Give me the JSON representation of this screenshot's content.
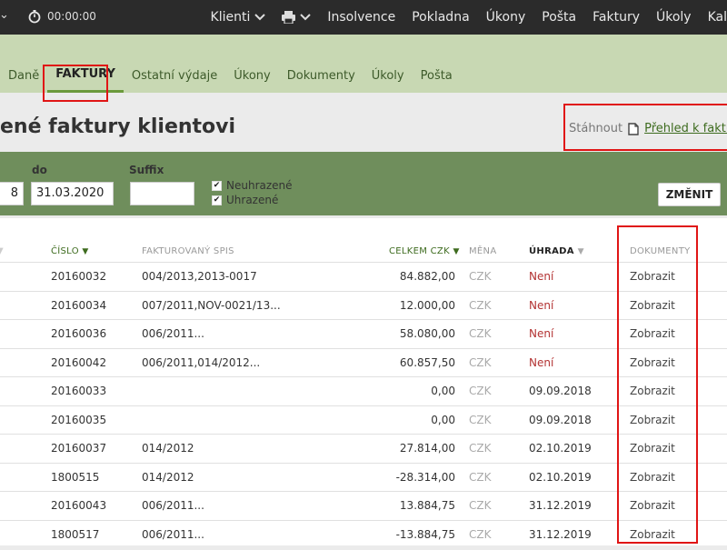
{
  "topbar": {
    "timer": "00:00:00",
    "nav": [
      {
        "label": "Klienti",
        "dropdown": true
      },
      {
        "label": "",
        "icon": "printer-icon",
        "dropdown": true
      },
      {
        "label": "Insolvence"
      },
      {
        "label": "Pokladna"
      },
      {
        "label": "Úkony"
      },
      {
        "label": "Pošta"
      },
      {
        "label": "Faktury"
      },
      {
        "label": "Úkoly"
      },
      {
        "label": "Kal"
      }
    ]
  },
  "tabs": [
    "Daně",
    "FAKTURY",
    "Ostatní výdaje",
    "Úkony",
    "Dokumenty",
    "Úkoly",
    "Pošta"
  ],
  "title": "ené faktury klientovi",
  "download": {
    "label": "Stáhnout",
    "link": "Přehled k fakturac"
  },
  "filter": {
    "from_label": "",
    "from_value": "8",
    "to_label": "do",
    "to_value": "31.03.2020",
    "suffix_label": "Suffix",
    "suffix_value": "",
    "checks": [
      {
        "label": "Neuhrazené",
        "checked": true
      },
      {
        "label": "Uhrazené",
        "checked": true
      }
    ],
    "button": "ZMĚNIT"
  },
  "table": {
    "headers": {
      "cislo": "ČÍSLO",
      "spis": "FAKTUROVANÝ SPIS",
      "celkem": "CELKEM CZK",
      "mena": "MĚNA",
      "uhrada": "ÚHRADA",
      "dokumenty": "DOKUMENTY"
    },
    "rows": [
      {
        "cislo": "20160032",
        "spis": "004/2013,2013-0017",
        "celkem": "84.882,00",
        "mena": "CZK",
        "uhrada": "Není",
        "unpaid": true,
        "doc": "Zobrazit"
      },
      {
        "cislo": "20160034",
        "spis": "007/2011,NOV-0021/13...",
        "celkem": "12.000,00",
        "mena": "CZK",
        "uhrada": "Není",
        "unpaid": true,
        "doc": "Zobrazit"
      },
      {
        "cislo": "20160036",
        "spis": "006/2011...",
        "celkem": "58.080,00",
        "mena": "CZK",
        "uhrada": "Není",
        "unpaid": true,
        "doc": "Zobrazit"
      },
      {
        "cislo": "20160042",
        "spis": "006/2011,014/2012...",
        "celkem": "60.857,50",
        "mena": "CZK",
        "uhrada": "Není",
        "unpaid": true,
        "doc": "Zobrazit"
      },
      {
        "cislo": "20160033",
        "spis": "",
        "celkem": "0,00",
        "mena": "CZK",
        "uhrada": "09.09.2018",
        "unpaid": false,
        "doc": "Zobrazit"
      },
      {
        "cislo": "20160035",
        "spis": "",
        "celkem": "0,00",
        "mena": "CZK",
        "uhrada": "09.09.2018",
        "unpaid": false,
        "doc": "Zobrazit"
      },
      {
        "cislo": "20160037",
        "spis": "014/2012",
        "celkem": "27.814,00",
        "mena": "CZK",
        "uhrada": "02.10.2019",
        "unpaid": false,
        "doc": "Zobrazit"
      },
      {
        "cislo": "1800515",
        "spis": "014/2012",
        "celkem": "-28.314,00",
        "mena": "CZK",
        "uhrada": "02.10.2019",
        "unpaid": false,
        "doc": "Zobrazit"
      },
      {
        "cislo": "20160043",
        "spis": "006/2011...",
        "celkem": "13.884,75",
        "mena": "CZK",
        "uhrada": "31.12.2019",
        "unpaid": false,
        "doc": "Zobrazit"
      },
      {
        "cislo": "1800517",
        "spis": "006/2011...",
        "celkem": "-13.884,75",
        "mena": "CZK",
        "uhrada": "31.12.2019",
        "unpaid": false,
        "doc": "Zobrazit"
      }
    ]
  }
}
